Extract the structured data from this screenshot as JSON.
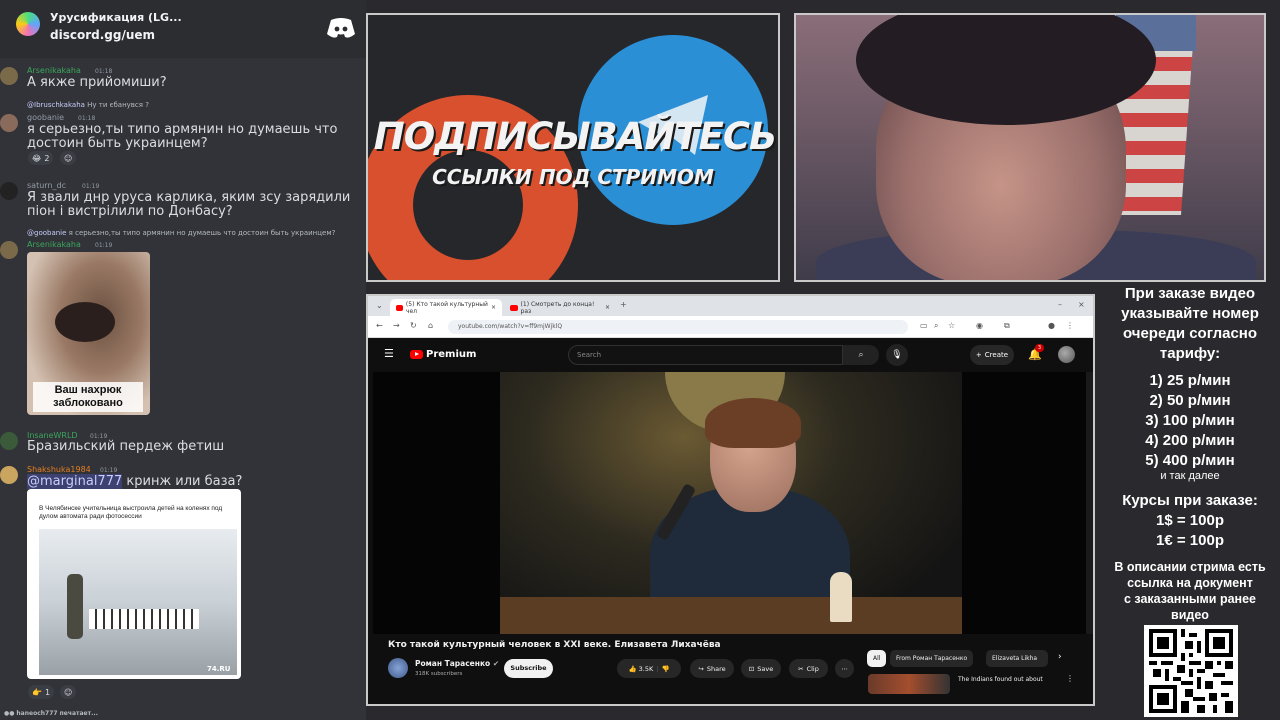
{
  "discord": {
    "server_name": "Урусификация (LG...",
    "server_link": "discord.gg/uem",
    "messages": [
      {
        "author": "Arsenikakaha",
        "time": "01:18",
        "text": "А якже прийомиши?"
      },
      {
        "reply_author": "@Ibruschkakaha",
        "reply_text": "Ну ти єбанувся ?",
        "author": "goobanie",
        "time": "01:18",
        "text": "я серьезно,ты типо армянин но думаешь что достоин быть украинцем?",
        "reaction_count": "2"
      },
      {
        "author": "saturn_dc",
        "time": "01:19",
        "text": "Я звали днр уруса карлика, яким зсу зарядили піон і вистрілили по Донбасу?"
      },
      {
        "reply_author": "@goobanie",
        "reply_text": "я серьезно,ты типо армянин но думаешь что достоин быть украинцем?",
        "author": "Arsenikakaha",
        "time": "01:19",
        "image_caption": "Ваш нахрюк заблоковано"
      },
      {
        "author": "InsaneWRLD",
        "time": "01:19",
        "text": "Бразильский пердеж фетиш"
      },
      {
        "author": "Shakshuka1984",
        "time": "01:19",
        "mention": "@marginal777",
        "text": "кринж или база?",
        "embed_text": "В Челябинске учительница выстроила детей на коленях под дулом автомата ради фотосессии",
        "embed_watermark": "74.RU",
        "reaction_count": "1"
      }
    ],
    "typing": "haneoch777 печатает..."
  },
  "promo": {
    "title": "ПОДПИСЫВАЙТЕСЬ",
    "subtitle": "ССЫЛКИ ПОД СТРИМОМ"
  },
  "browser": {
    "tabs": [
      {
        "label": "(5) Кто такой культурный чел"
      },
      {
        "label": "(1) Смотреть до конца! раз"
      }
    ],
    "url": "youtube.com/watch?v=ff9mjWjklQ",
    "youtube": {
      "logo": "Premium",
      "search_placeholder": "Search",
      "create_label": "Create",
      "notif_count": "3",
      "video_title": "Кто такой культурный человек в XXI веке. Елизавета Лихачёва",
      "channel_name": "Роман Тарасенко",
      "channel_subs": "318K subscribers",
      "subscribe_label": "Subscribe",
      "likes": "3.5K",
      "share_label": "Share",
      "save_label": "Save",
      "clip_label": "Clip",
      "chips": [
        "All",
        "From Роман Тарасенко",
        "Elizaveta Likha"
      ],
      "rec_title": "The Indians found out about"
    }
  },
  "info": {
    "heading": [
      "При заказе видео",
      "указывайте номер",
      "очереди согласно",
      "тарифу:"
    ],
    "tariffs": [
      "1) 25 р/мин",
      "2) 50 р/мин",
      "3) 100 р/мин",
      "4) 200 р/мин",
      "5) 400 р/мин"
    ],
    "tariffs_note": "и так далее",
    "courses_title": "Курсы при заказе:",
    "courses": [
      "1$ = 100р",
      "1€ = 100р"
    ],
    "description": [
      "В описании стрима есть",
      "ссылка на документ",
      "с заказанными ранее",
      "видео"
    ]
  },
  "colors": {
    "discord_bg": "#313338",
    "mention": "#c9cdfb",
    "author_green": "#3ba55c",
    "author_orange": "#e67e22"
  }
}
